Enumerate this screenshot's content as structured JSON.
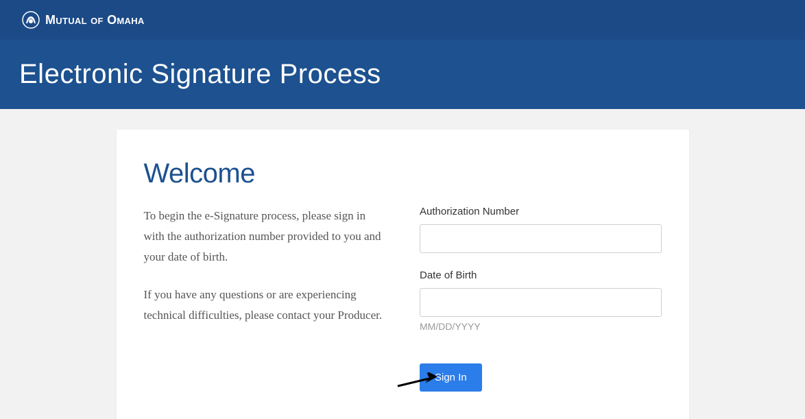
{
  "brand": {
    "name": "Mutual of Omaha"
  },
  "hero": {
    "title": "Electronic Signature Process"
  },
  "card": {
    "heading": "Welcome",
    "para1": "To begin the e-Signature process, please sign in with the authorization number provided to you and your date of birth.",
    "para2": "If you have any questions or are experiencing technical difficulties, please contact your Producer."
  },
  "form": {
    "auth_label": "Authorization Number",
    "auth_value": "",
    "dob_label": "Date of Birth",
    "dob_value": "",
    "dob_hint": "MM/DD/YYYY",
    "signin_label": "Sign In"
  }
}
